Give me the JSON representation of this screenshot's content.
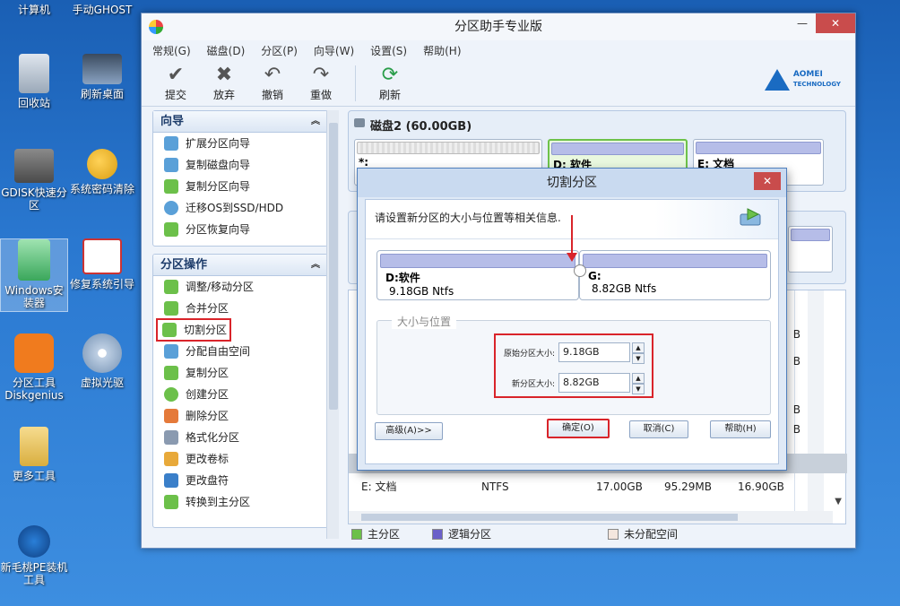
{
  "desktop": {
    "icons": [
      {
        "label": "计算机",
        "color": "#5d8ec9"
      },
      {
        "label": "手动GHOST",
        "color": "#f0a21e"
      },
      {
        "label": "回收站",
        "color": "#b9c3cf"
      },
      {
        "label": "刷新桌面",
        "color": "#4a5a6e"
      },
      {
        "label": "GDISK快速分区",
        "color": "#7b7b7b"
      },
      {
        "label": "系统密码清除",
        "color": "#e6b534"
      },
      {
        "label": "Windows安装器",
        "color": "#6abf7a"
      },
      {
        "label": "修复系统引导",
        "color": "#e7e7e7"
      },
      {
        "label": "分区工具Diskgenius",
        "color": "#f07b1e"
      },
      {
        "label": "虚拟光驱",
        "color": "#c7d5e6"
      },
      {
        "label": "更多工具",
        "color": "#e6c46c"
      },
      {
        "label": "新毛桃PE装机工具",
        "color": "#1e5fb4"
      }
    ]
  },
  "window": {
    "title": "分区助手专业版",
    "menu": [
      "常规(G)",
      "磁盘(D)",
      "分区(P)",
      "向导(W)",
      "设置(S)",
      "帮助(H)"
    ],
    "toolbar": [
      {
        "label": "提交",
        "icon": "check-icon"
      },
      {
        "label": "放弃",
        "icon": "cross-icon"
      },
      {
        "label": "撤销",
        "icon": "undo-icon"
      },
      {
        "label": "重做",
        "icon": "redo-icon"
      },
      {
        "label": "刷新",
        "icon": "refresh-icon"
      }
    ],
    "brand": {
      "name": "AOMEI",
      "sub": "TECHNOLOGY"
    }
  },
  "sidebar": {
    "wizard": {
      "title": "向导",
      "items": [
        "扩展分区向导",
        "复制磁盘向导",
        "复制分区向导",
        "迁移OS到SSD/HDD",
        "分区恢复向导"
      ]
    },
    "ops": {
      "title": "分区操作",
      "items": [
        "调整/移动分区",
        "合并分区",
        "切割分区",
        "分配自由空间",
        "复制分区",
        "创建分区",
        "删除分区",
        "格式化分区",
        "更改卷标",
        "更改盘符",
        "转换到主分区"
      ]
    }
  },
  "disk": {
    "title": "磁盘2 (60.00GB)",
    "parts": [
      {
        "label": "*:"
      },
      {
        "label": "D: 软件"
      },
      {
        "label": "E: 文档"
      }
    ]
  },
  "table": {
    "last_row": {
      "name": "E: 文档",
      "fs": "NTFS",
      "cap": "17.00GB",
      "used": "95.29MB",
      "free": "16.90GB"
    },
    "right_col_values": [
      "B",
      "B",
      "B",
      "B"
    ]
  },
  "legend": [
    "主分区",
    "逻辑分区",
    "未分配空间"
  ],
  "legend_colors": [
    "#6cc04a",
    "#6a5fc9",
    "#f4e7de"
  ],
  "dialog": {
    "title": "切割分区",
    "info": "请设置新分区的大小与位置等相关信息.",
    "left_part": {
      "name": "D:软件",
      "size": "9.18GB Ntfs"
    },
    "right_part": {
      "name": "G:",
      "size": "8.82GB Ntfs"
    },
    "group_title": "大小与位置",
    "orig_label": "原始分区大小:",
    "orig_value": "9.18GB",
    "new_label": "新分区大小:",
    "new_value": "8.82GB",
    "advanced": "高级(A)>>",
    "ok": "确定(O)",
    "cancel": "取消(C)",
    "help": "帮助(H)"
  }
}
